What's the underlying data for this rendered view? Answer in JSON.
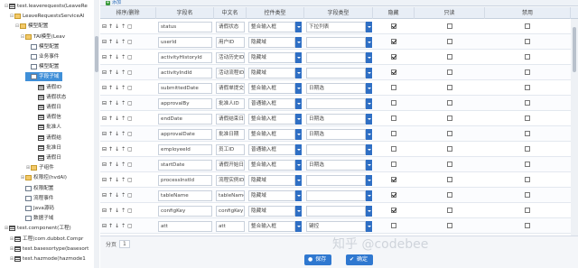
{
  "tree": {
    "nodes": [
      {
        "label": "test.leaverequests(LeaveRe",
        "icon": "grid",
        "toggle": "⊟",
        "selected": false
      },
      {
        "label": "LeaveRequestsServiceAl",
        "icon": "folder",
        "toggle": "⊟",
        "selected": false
      },
      {
        "label": "模型配置",
        "icon": "folder",
        "toggle": "⊟",
        "selected": false
      },
      {
        "label": "TAI模型(Leav",
        "icon": "folder",
        "toggle": "⊟",
        "selected": false
      },
      {
        "label": "模型配置",
        "icon": "page",
        "toggle": "",
        "selected": false
      },
      {
        "label": "业务事件",
        "icon": "page",
        "toggle": "",
        "selected": false
      },
      {
        "label": "模型配置",
        "icon": "page",
        "toggle": "",
        "selected": false
      },
      {
        "label": "字段子域",
        "icon": "page",
        "toggle": "",
        "selected": true
      },
      {
        "label": "请假ID",
        "icon": "grid",
        "toggle": "",
        "selected": false
      },
      {
        "label": "请假状态",
        "icon": "grid",
        "toggle": "",
        "selected": false
      },
      {
        "label": "请假日",
        "icon": "grid",
        "toggle": "",
        "selected": false
      },
      {
        "label": "请假信",
        "icon": "grid",
        "toggle": "",
        "selected": false
      },
      {
        "label": "批准人",
        "icon": "grid",
        "toggle": "",
        "selected": false
      },
      {
        "label": "请假结",
        "icon": "grid",
        "toggle": "",
        "selected": false
      },
      {
        "label": "批准日",
        "icon": "grid",
        "toggle": "",
        "selected": false
      },
      {
        "label": "请假日",
        "icon": "grid",
        "toggle": "",
        "selected": false
      },
      {
        "label": "子组件",
        "icon": "folder",
        "toggle": "⊞",
        "selected": false
      },
      {
        "label": "权限控(hvdAl)",
        "icon": "folder",
        "toggle": "⊞",
        "selected": false
      },
      {
        "label": "权限配置",
        "icon": "page",
        "toggle": "",
        "selected": false
      },
      {
        "label": "流程事件",
        "icon": "page",
        "toggle": "",
        "selected": false
      },
      {
        "label": "Java源码",
        "icon": "page",
        "toggle": "",
        "selected": false
      },
      {
        "label": "数据子域",
        "icon": "page",
        "toggle": "",
        "selected": false
      },
      {
        "label": "test.component(工程)",
        "icon": "grid",
        "toggle": "⊞",
        "selected": false
      },
      {
        "label": "工程(com.dubbot.Compr",
        "icon": "grid",
        "toggle": "⊞",
        "selected": false
      },
      {
        "label": "test.basesortype(basesort",
        "icon": "grid",
        "toggle": "⊞",
        "selected": false
      },
      {
        "label": "test.hazmode(hazmode1",
        "icon": "grid",
        "toggle": "⊞",
        "selected": false
      }
    ]
  },
  "toolbar": {
    "add_label": "添加"
  },
  "grid": {
    "headers": {
      "ops": "排序/删除",
      "field_name": "字段名",
      "cn_name": "中文名",
      "control_type": "控件类型",
      "field_type": "字段类型",
      "hidden": "隐藏",
      "readonly": "只读",
      "disabled": "禁用"
    },
    "rows": [
      {
        "field": "status",
        "cn": "请假状态",
        "ctl": "整合输入框",
        "ftype": "下拉列表",
        "hidden": true,
        "readonly": false,
        "disabled": false
      },
      {
        "field": "userId",
        "cn": "用户ID",
        "ctl": "隐藏域",
        "ftype": "",
        "hidden": true,
        "readonly": false,
        "disabled": false
      },
      {
        "field": "activityHistoryId",
        "cn": "活动历史ID",
        "ctl": "隐藏域",
        "ftype": "",
        "hidden": true,
        "readonly": false,
        "disabled": false
      },
      {
        "field": "activityIndId",
        "cn": "活动流程ID",
        "ctl": "隐藏域",
        "ftype": "",
        "hidden": true,
        "readonly": false,
        "disabled": false
      },
      {
        "field": "submittedDate",
        "cn": "请假单提交日期",
        "ctl": "整合输入框",
        "ftype": "日期选",
        "hidden": false,
        "readonly": false,
        "disabled": false
      },
      {
        "field": "approvalBy",
        "cn": "批准人ID",
        "ctl": "普通输入框",
        "ftype": "",
        "hidden": false,
        "readonly": false,
        "disabled": false
      },
      {
        "field": "endDate",
        "cn": "请假结束日期",
        "ctl": "整合输入框",
        "ftype": "日期选",
        "hidden": false,
        "readonly": false,
        "disabled": false
      },
      {
        "field": "approvalDate",
        "cn": "批准日期",
        "ctl": "整合输入框",
        "ftype": "日期选",
        "hidden": false,
        "readonly": false,
        "disabled": false
      },
      {
        "field": "employeeId",
        "cn": "员工ID",
        "ctl": "普通输入框",
        "ftype": "",
        "hidden": false,
        "readonly": false,
        "disabled": false
      },
      {
        "field": "startDate",
        "cn": "请假开始日期",
        "ctl": "整合输入框",
        "ftype": "日期选",
        "hidden": false,
        "readonly": false,
        "disabled": false
      },
      {
        "field": "processInstId",
        "cn": "流程实例ID",
        "ctl": "隐藏域",
        "ftype": "",
        "hidden": true,
        "readonly": false,
        "disabled": false
      },
      {
        "field": "tableName",
        "cn": "tableName",
        "ctl": "隐藏域",
        "ftype": "",
        "hidden": true,
        "readonly": false,
        "disabled": false
      },
      {
        "field": "configKey",
        "cn": "configKey",
        "ctl": "隐藏域",
        "ftype": "",
        "hidden": true,
        "readonly": false,
        "disabled": false
      },
      {
        "field": "att",
        "cn": "att",
        "ctl": "整合输入框",
        "ftype": "键控",
        "hidden": false,
        "readonly": false,
        "disabled": false
      }
    ]
  },
  "footer": {
    "pager_label": "分页",
    "page_value": "1",
    "save_label": "保存",
    "ok_label": "确定"
  },
  "watermark": "知乎 @codebee",
  "colors": {
    "accent": "#2f78d0",
    "tree_selected": "#3f8fd8"
  }
}
